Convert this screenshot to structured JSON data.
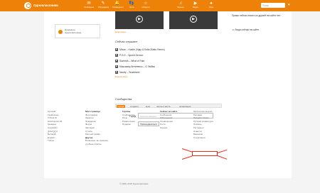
{
  "header": {
    "site_name": "Одноклассники",
    "nav": [
      {
        "label": "Сообщения",
        "icon": "envelope-icon",
        "glyph": "✉"
      },
      {
        "label": "Обсуждения",
        "icon": "chat-icon",
        "glyph": "✎"
      },
      {
        "label": "Оповещения",
        "icon": "bell-icon",
        "glyph": "🔔"
      },
      {
        "label": "Гости",
        "icon": "footprints-icon",
        "glyph": "👣"
      },
      {
        "label": "События",
        "icon": "event-icon",
        "glyph": "☆"
      },
      {
        "label": "Музыка",
        "icon": "music-icon",
        "glyph": "♫"
      },
      {
        "label": "Видео",
        "icon": "video-icon",
        "glyph": "▶"
      },
      {
        "label": "Игры",
        "icon": "games-icon",
        "glyph": "♠"
      }
    ],
    "search_placeholder": "Поиск"
  },
  "left": {
    "indicator_line1": "Индикатор",
    "indicator_line2": "Одноклассников"
  },
  "videos": {
    "captions": [
      "Разбойничьи истории",
      "Как правильно под нос? Хорошие позы..."
    ],
    "more_link": "Ещё видео"
  },
  "music": {
    "title": "Сейчас слушают",
    "tracks": [
      "Mixan – Hustle (Vijay & Sofia Zlatko Remix)",
      "P.O.D – Speed Demon",
      "Stahovik – What of Fate",
      "Максимир Антипенко – О Любви",
      "Nautty – Snakeskin"
    ],
    "more_link": "Ещё музыка"
  },
  "communities": {
    "title": "Сообщества",
    "tabs": [
      "города",
      "холдинги",
      "вузы",
      "школы и места",
      "организации"
    ],
    "city_label": "Город",
    "city_placeholder": "Начните вводить",
    "find_button": "Присоединиться"
  },
  "right": {
    "text1": "Прямо сейчас никого из друзей на сайте нет",
    "text2": "Люди сейчас на сайте"
  },
  "footer": {
    "col1": [
      "Русский",
      "Українська",
      "O'zbek tili",
      "Azərbaycan dili",
      "Қазақша",
      "Հայերեն",
      "ქართული",
      "Română",
      "English",
      "Türkçe"
    ],
    "col2_title": "Моя страница",
    "col2": [
      "Фотографии",
      "Заметки",
      "Праздники",
      "Форум",
      "Закладки",
      "О себе",
      "Мои настройки"
    ],
    "col2_extra_title": "Другие",
    "col2_extra": [
      "Возможно, вы знакомы",
      "учебные классы"
    ],
    "col3_title": "Группы",
    "col3": [
      "Сообщества",
      "Игры",
      "Развлечения",
      "Подарки"
    ],
    "col4_title": "Сейчас на сайте",
    "col4": [
      "Сообщения",
      "Обсуждения",
      "Оповещения",
      "Гости",
      "Оценки"
    ],
    "col5": [
      "Мобильная версия",
      "Реклама",
      "Разработчикам",
      "Русская клавиатура",
      "Помощь",
      "Регламент",
      "Новости",
      "Вакансии",
      "О компании"
    ],
    "copyright": "© 2006–2015 Одноклассники"
  }
}
